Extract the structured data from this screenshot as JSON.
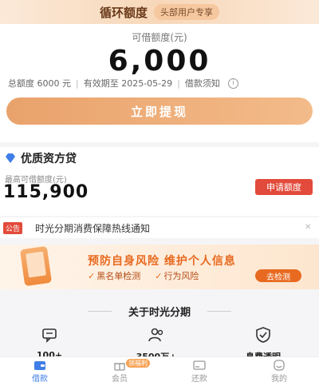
{
  "banner": {
    "title": "循环额度",
    "tag": "头部用户专享"
  },
  "quota": {
    "label": "可借额度(元)",
    "value": "6,000",
    "total": "总额度 6000 元",
    "validity": "有效期至 2025-05-29",
    "notice": "借款须知",
    "button": "立即提现"
  },
  "loan": {
    "title": "优质资方贷",
    "sub_label": "最高可借额度(元)",
    "amount": "115,900",
    "apply_button": "申请额度"
  },
  "announcement": {
    "tag": "公告",
    "text": "时光分期消费保障热线通知"
  },
  "promo": {
    "title": "预防自身风险  维护个人信息",
    "items": [
      "黑名单检测",
      "行为风险"
    ],
    "button": "去检测"
  },
  "about": {
    "title": "关于时光分期",
    "features": [
      {
        "label": "100+",
        "icon": "chat-icon"
      },
      {
        "label": "3500万+",
        "icon": "users-icon"
      },
      {
        "label": "息费透明",
        "icon": "shield-check-icon"
      }
    ]
  },
  "tabs": [
    {
      "label": "借款",
      "icon": "wallet-icon",
      "active": true
    },
    {
      "label": "会员",
      "icon": "gift-icon",
      "badge": "领福利"
    },
    {
      "label": "还款",
      "icon": "card-icon"
    },
    {
      "label": "我的",
      "icon": "profile-icon"
    }
  ],
  "colors": {
    "accent": "#e9a26b",
    "brand_blue": "#3f7ee8",
    "alert_red": "#e24a3b",
    "promo_orange": "#e86a20"
  }
}
